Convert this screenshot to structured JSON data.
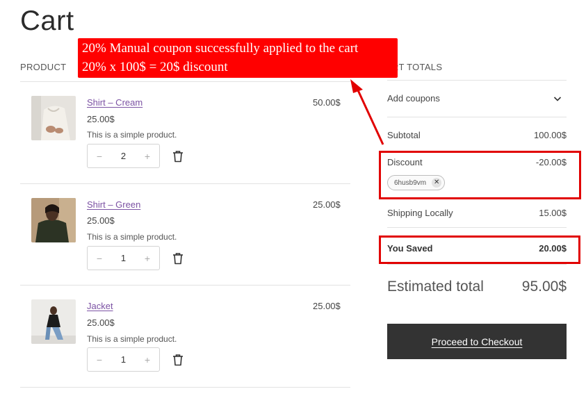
{
  "page": {
    "title": "Cart"
  },
  "columns": {
    "product": "PRODUCT",
    "totals": "CART TOTALS",
    "totals_visible": "RT TOTALS"
  },
  "items": [
    {
      "name": "Shirt – Cream",
      "price": "25.00$",
      "description": "This is a simple product.",
      "quantity": "2",
      "total": "50.00$",
      "image": "shirt-cream-photo"
    },
    {
      "name": "Shirt – Green",
      "price": "25.00$",
      "description": "This is a simple product.",
      "quantity": "1",
      "total": "25.00$",
      "image": "shirt-green-photo"
    },
    {
      "name": "Jacket",
      "price": "25.00$",
      "description": "This is a simple product.",
      "quantity": "1",
      "total": "25.00$",
      "image": "jacket-photo"
    }
  ],
  "quantity_controls": {
    "minus": "−",
    "plus": "+"
  },
  "totals": {
    "add_coupons": "Add coupons",
    "subtotal_label": "Subtotal",
    "subtotal_value": "100.00$",
    "discount_label": "Discount",
    "discount_value": "-20.00$",
    "coupon_code": "6husb9vm",
    "coupon_remove": "✕",
    "shipping_label": "Shipping Locally",
    "shipping_value": "15.00$",
    "saved_label": "You Saved",
    "saved_value": "20.00$",
    "estimated_label": "Estimated total",
    "estimated_value": "95.00$",
    "checkout_label": "Proceed to Checkout"
  },
  "annotation": {
    "line1": "20% Manual coupon successfully applied to the cart",
    "line2": "20% x 100$ = 20$ discount"
  },
  "colors": {
    "accent_link": "#7b51a3",
    "annotation_red": "#ff0000",
    "highlight_border": "#e10000",
    "checkout_bg": "#333333"
  }
}
